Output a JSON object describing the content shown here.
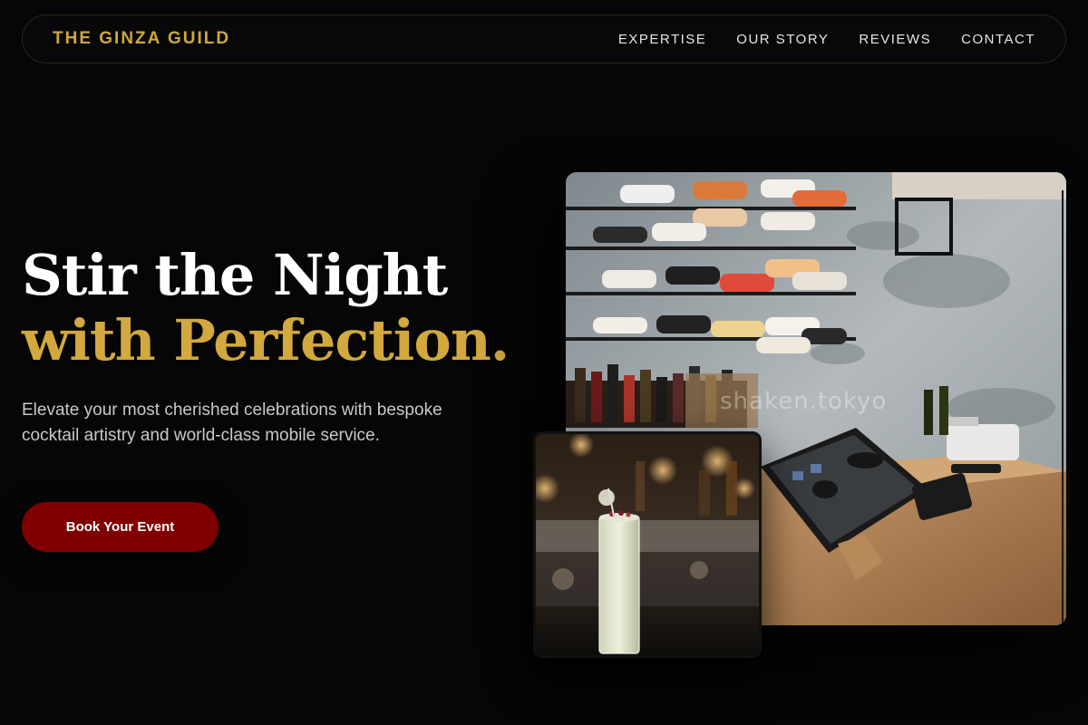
{
  "nav": {
    "brand": "THE GINZA GUILD",
    "links": [
      "EXPERTISE",
      "OUR STORY",
      "REVIEWS",
      "CONTACT"
    ]
  },
  "hero": {
    "title_line1": "Stir the Night",
    "title_line2": "with Perfection.",
    "subtitle": "Elevate your most cherished celebrations with bespoke cocktail artistry and world-class mobile service.",
    "cta_label": "Book Your Event"
  },
  "images": {
    "main_watermark": "shaken.tokyo",
    "main_alt": "bar-interior-with-wine-rack-and-tablet-pos",
    "secondary_alt": "tall-cocktail-glass-in-bar"
  },
  "colors": {
    "accent_gold": "#d2a83f",
    "button_red": "#800000",
    "background": "#060606"
  }
}
